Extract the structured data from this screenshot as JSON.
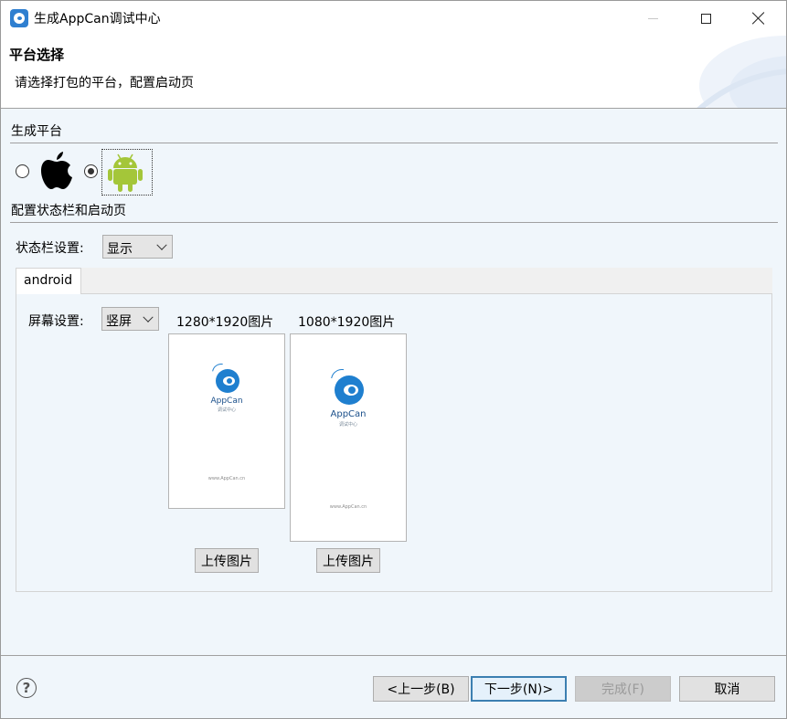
{
  "window": {
    "title": "生成AppCan调试中心",
    "controls": [
      "minimize-icon",
      "maximize-icon",
      "close-icon"
    ]
  },
  "header": {
    "title": "平台选择",
    "description": "请选择打包的平台，配置启动页"
  },
  "platform_section": {
    "label": "生成平台",
    "options": [
      {
        "name": "ios",
        "icon": "apple-icon",
        "selected": false
      },
      {
        "name": "android",
        "icon": "android-icon",
        "selected": true
      }
    ]
  },
  "config_section": {
    "label": "配置状态栏和启动页",
    "statusbar_label": "状态栏设置:",
    "statusbar_value": "显示"
  },
  "tabs": [
    {
      "label": "android",
      "active": true
    }
  ],
  "android_tab": {
    "screen_label": "屏幕设置:",
    "screen_value": "竖屏",
    "images": [
      {
        "caption": "1280*1920图片",
        "brand": "AppCan",
        "sub": "调试中心",
        "url": "www.AppCan.cn",
        "upload_label": "上传图片"
      },
      {
        "caption": "1080*1920图片",
        "brand": "AppCan",
        "sub": "调试中心",
        "url": "www.AppCan.cn",
        "upload_label": "上传图片"
      }
    ]
  },
  "footer": {
    "help_icon": "?",
    "back_label": "<上一步(B)",
    "next_label": "下一步(N)>",
    "finish_label": "完成(F)",
    "cancel_label": "取消"
  },
  "colors": {
    "accent": "#3c7fb1",
    "android_green": "#a4c639",
    "brand_blue": "#1f7fcf"
  }
}
